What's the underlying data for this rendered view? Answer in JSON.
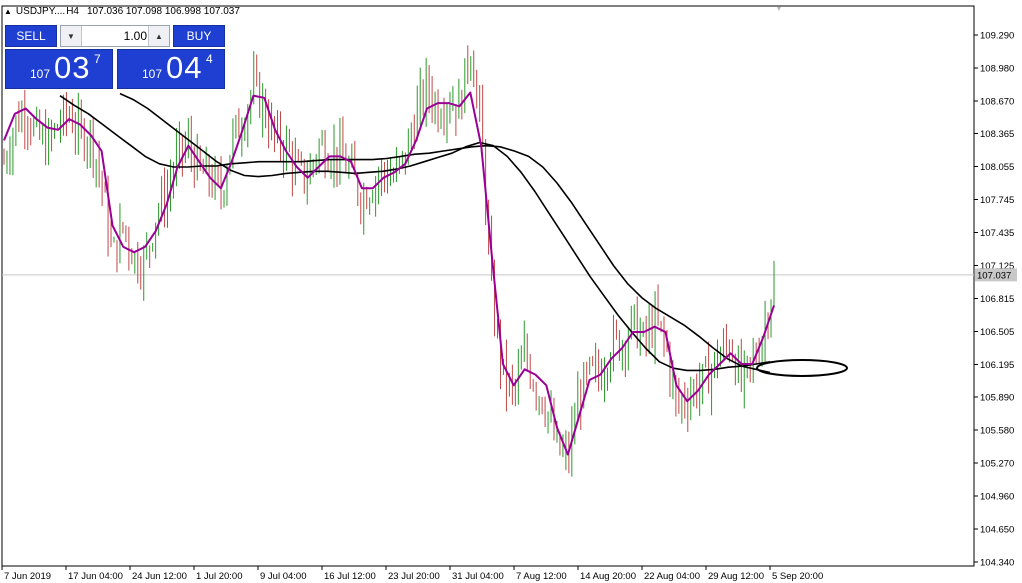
{
  "header": {
    "symbol": "USDJPY....",
    "timeframe": "H4",
    "ohlc": "107.036 107.098 106.998 107.037"
  },
  "trade_panel": {
    "sell_label": "SELL",
    "buy_label": "BUY",
    "lot_value": "1.00",
    "sell_price_prefix": "107",
    "sell_price_big": "03",
    "sell_price_sup": "7",
    "buy_price_prefix": "107",
    "buy_price_big": "04",
    "buy_price_sup": "4"
  },
  "colors": {
    "bull": "#2b9a2b",
    "bear": "#c04848",
    "fast_ma": "#9a0096",
    "slow_ma": "#000000",
    "price_line": "#c8c8c8"
  },
  "chart_data": {
    "type": "candlestick",
    "y_ticks": [
      109.29,
      108.98,
      108.67,
      108.365,
      108.055,
      107.745,
      107.435,
      107.125,
      106.815,
      106.505,
      106.195,
      105.89,
      105.58,
      105.27,
      104.96,
      104.65,
      104.34
    ],
    "y_tick_labels": [
      "109.290",
      "108.980",
      "108.670",
      "108.365",
      "108.055",
      "107.745",
      "107.435",
      "107.125",
      "106.815",
      "106.505",
      "106.195",
      "105.890",
      "105.580",
      "105.270",
      "104.960",
      "104.650",
      "104.340"
    ],
    "current_price": 107.037,
    "current_price_label": "107.037",
    "x_labels": [
      "7 Jun 2019",
      "17 Jun 04:00",
      "24 Jun 12:00",
      "1 Jul 20:00",
      "9 Jul 04:00",
      "16 Jul 12:00",
      "23 Jul 20:00",
      "31 Jul 04:00",
      "7 Aug 12:00",
      "14 Aug 20:00",
      "22 Aug 04:00",
      "29 Aug 12:00",
      "5 Sep 20:00"
    ],
    "close_path": [
      108.1,
      108.45,
      108.6,
      108.35,
      108.25,
      108.45,
      108.55,
      108.35,
      108.35,
      107.9,
      107.2,
      107.5,
      107.2,
      107.15,
      107.6,
      107.8,
      108.15,
      108.25,
      108.0,
      107.95,
      107.8,
      108.3,
      108.5,
      108.8,
      108.6,
      108.3,
      108.25,
      108.0,
      107.95,
      108.25,
      108.2,
      108.15,
      108.0,
      107.75,
      107.9,
      108.0,
      107.95,
      108.15,
      108.55,
      108.8,
      108.6,
      108.7,
      108.6,
      109.2,
      108.4,
      106.8,
      106.1,
      105.9,
      106.3,
      106.0,
      105.8,
      105.4,
      105.3,
      105.9,
      106.1,
      106.1,
      106.4,
      106.4,
      106.6,
      106.4,
      106.6,
      106.4,
      105.8,
      105.9,
      106.0,
      106.1,
      106.3,
      106.4,
      106.0,
      106.2,
      106.5,
      107.0
    ],
    "fast_ma": [
      108.3,
      108.55,
      108.6,
      108.5,
      108.42,
      108.4,
      108.5,
      108.45,
      108.35,
      108.2,
      107.5,
      107.3,
      107.25,
      107.3,
      107.45,
      107.7,
      108.05,
      108.25,
      108.1,
      107.95,
      107.85,
      108.1,
      108.4,
      108.72,
      108.7,
      108.4,
      108.2,
      108.05,
      107.95,
      108.05,
      108.15,
      108.15,
      108.1,
      107.85,
      107.85,
      107.95,
      108.0,
      108.08,
      108.3,
      108.6,
      108.65,
      108.65,
      108.62,
      108.75,
      108.25,
      107.2,
      106.2,
      106.0,
      106.15,
      106.1,
      106.0,
      105.6,
      105.35,
      105.7,
      106.05,
      106.1,
      106.25,
      106.35,
      106.5,
      106.5,
      106.55,
      106.5,
      106.0,
      105.85,
      105.95,
      106.1,
      106.2,
      106.3,
      106.2,
      106.2,
      106.45,
      106.75
    ],
    "ma_slow_1": [
      108.72,
      108.63,
      108.55,
      108.45,
      108.35,
      108.25,
      108.15,
      108.08,
      108.05,
      108.05,
      108.06,
      108.06,
      108.08,
      108.09,
      108.1,
      108.1,
      108.1,
      108.1,
      108.11,
      108.12,
      108.12,
      108.12,
      108.12,
      108.13,
      108.15,
      108.17,
      108.18,
      108.2,
      108.22,
      108.24,
      108.25,
      108.24,
      108.2,
      108.15,
      108.05,
      107.9,
      107.72,
      107.52,
      107.32,
      107.12,
      106.95,
      106.82,
      106.72,
      106.64,
      106.56,
      106.46,
      106.35,
      106.25,
      106.18,
      106.15,
      106.12
    ],
    "ma_slow_2": [
      108.74,
      108.68,
      108.6,
      108.5,
      108.4,
      108.3,
      108.2,
      108.1,
      108.02,
      107.97,
      107.96,
      107.97,
      107.99,
      108.0,
      108.01,
      108.01,
      108.0,
      107.99,
      108.0,
      108.01,
      108.03,
      108.06,
      108.1,
      108.14,
      108.18,
      108.24,
      108.28,
      108.25,
      108.15,
      108.0,
      107.82,
      107.62,
      107.42,
      107.22,
      107.02,
      106.84,
      106.66,
      106.5,
      106.35,
      106.22,
      106.16,
      106.14,
      106.14,
      106.15,
      106.17,
      106.18,
      106.2,
      106.22
    ]
  }
}
